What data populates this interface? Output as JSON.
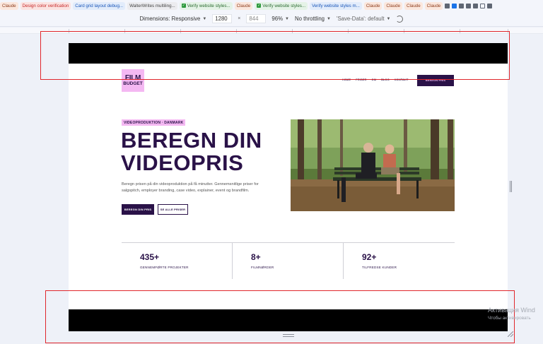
{
  "bookmarks": [
    {
      "label": "Claude",
      "style": "orange"
    },
    {
      "label": "Design color verification",
      "style": "red"
    },
    {
      "label": "Card grid layout debug...",
      "style": "blue"
    },
    {
      "label": "WalterWrites multiling...",
      "style": "gray"
    },
    {
      "label": "Verify website styles...",
      "style": "check"
    },
    {
      "label": "Claude",
      "style": "orange"
    },
    {
      "label": "Verify website styles...",
      "style": "check"
    },
    {
      "label": "Verify website styles m...",
      "style": "blue"
    },
    {
      "label": "Claude",
      "style": "orange"
    },
    {
      "label": "Claude",
      "style": "orange"
    },
    {
      "label": "Claude",
      "style": "orange"
    },
    {
      "label": "Claude",
      "style": "orange"
    }
  ],
  "device_toolbar": {
    "dimensions_label": "Dimensions: Responsive",
    "width": "1280",
    "times": "×",
    "height": "844",
    "zoom": "96%",
    "throttling": "No throttling",
    "save_data": "'Save-Data': default"
  },
  "site": {
    "logo_line1": "FILM",
    "logo_line2": "BUDGET",
    "nav": [
      "HOME",
      "PRISER",
      "OM",
      "BLOG",
      "KONTAKT"
    ],
    "cta_top": "BEREGN PRIS",
    "tag": "VIDEOPRODUKTION · DANMARK",
    "headline_line1": "BEREGN DIN",
    "headline_line2": "VIDEOPRIS",
    "lead": "Beregn prisen på din videoproduktion på få minutter. Gennemsnitlige priser for salgspitch, employer branding, case video, explainer, event og brandfilm.",
    "btn_primary": "BEREGN DIN PRIS",
    "btn_secondary": "SE ALLE PRISER",
    "stats": [
      {
        "value": "435+",
        "label": "GENNEMFØRTE PROJEKTER"
      },
      {
        "value": "8+",
        "label": "FILMNØRDER"
      },
      {
        "value": "92+",
        "label": "TILFREDSE KUNDER"
      }
    ]
  },
  "watermark": {
    "line1": "Активация Wind",
    "line2": "Чтобы активировать"
  },
  "colors": {
    "brand_purple": "#2a1248",
    "brand_pink": "#f4b8f2",
    "annotation_red": "#e0262b"
  }
}
